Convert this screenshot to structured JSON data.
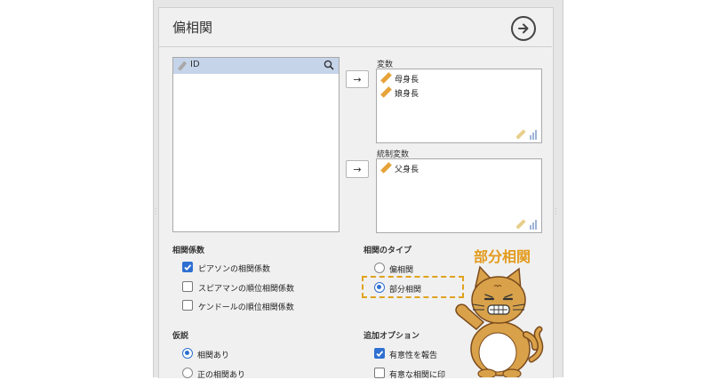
{
  "title": "偏相関",
  "colors": {
    "accent": "#2f6fd1",
    "highlight": "#e0a21d",
    "selected_row": "#c6d4ea"
  },
  "source_list": {
    "items": [
      {
        "label": "ID",
        "icon": "ruler-icon"
      }
    ],
    "search_icon": "search-icon"
  },
  "variables": {
    "label": "変数",
    "items": [
      "母身長",
      "娘身長"
    ]
  },
  "controls": {
    "label": "統制変数",
    "items": [
      "父身長"
    ]
  },
  "move_button_label": "→",
  "correlation_coefficients": {
    "label": "相関係数",
    "options": [
      {
        "label": "ピアソンの相関係数",
        "checked": true
      },
      {
        "label": "スピアマンの順位相関係数",
        "checked": false
      },
      {
        "label": "ケンドールの順位相関係数",
        "checked": false
      }
    ]
  },
  "correlation_type": {
    "label": "相関のタイプ",
    "options": [
      {
        "label": "偏相関",
        "selected": false
      },
      {
        "label": "部分相関",
        "selected": true
      }
    ]
  },
  "hypothesis": {
    "label": "仮説",
    "options": [
      {
        "label": "相関あり",
        "selected": true
      },
      {
        "label": "正の相関あり",
        "selected": false
      }
    ]
  },
  "additional_options": {
    "label": "追加オプション",
    "options": [
      {
        "label": "有意性を報告",
        "checked": true
      },
      {
        "label": "有意な相関に印",
        "checked": false
      }
    ]
  },
  "callout": "部分相関"
}
